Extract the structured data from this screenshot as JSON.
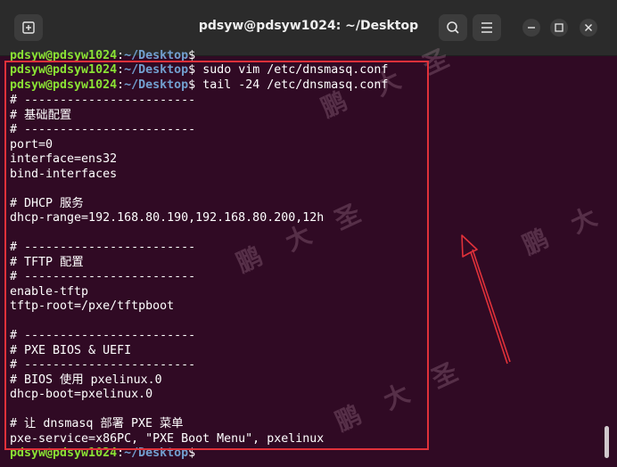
{
  "window": {
    "title": "pdsyw@pdsyw1024: ~/Desktop"
  },
  "icons": {
    "new_tab": "new-tab-icon",
    "search": "search-icon",
    "menu": "hamburger-menu-icon",
    "minimize": "minimize-icon",
    "maximize": "maximize-icon",
    "close": "close-icon"
  },
  "prompt": {
    "user_host": "pdsyw@pdsyw1024",
    "colon": ":",
    "path": "~/Desktop",
    "dollar": "$"
  },
  "commands": {
    "line0": "",
    "line1": " sudo vim /etc/dnsmasq.conf",
    "line2": " tail -24 /etc/dnsmasq.conf",
    "last": ""
  },
  "output": [
    "# ------------------------",
    "# 基础配置",
    "# ------------------------",
    "port=0",
    "interface=ens32",
    "bind-interfaces",
    "",
    "# DHCP 服务",
    "dhcp-range=192.168.80.190,192.168.80.200,12h",
    "",
    "# ------------------------",
    "# TFTP 配置",
    "# ------------------------",
    "enable-tftp",
    "tftp-root=/pxe/tftpboot",
    "",
    "# ------------------------",
    "# PXE BIOS & UEFI",
    "# ------------------------",
    "# BIOS 使用 pxelinux.0",
    "dhcp-boot=pxelinux.0",
    "",
    "# 让 dnsmasq 部署 PXE 菜单",
    "pxe-service=x86PC, \"PXE Boot Menu\", pxelinux"
  ],
  "watermark": {
    "chars": [
      "鹏",
      "大",
      "圣"
    ]
  },
  "colors": {
    "background": "#300a24",
    "prompt_user": "#8ae234",
    "prompt_path": "#729fcf",
    "annotation": "#e0313a"
  }
}
